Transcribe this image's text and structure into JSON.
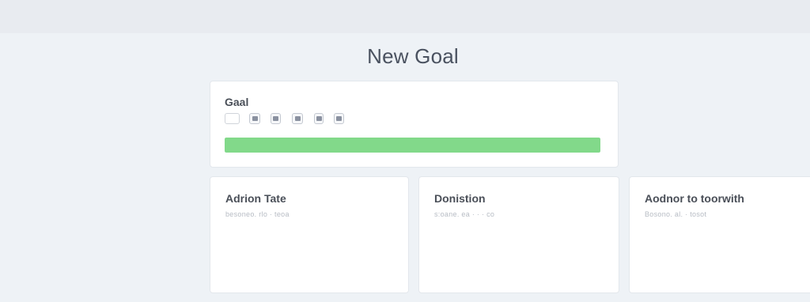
{
  "page": {
    "title": "New Goal"
  },
  "goal_card": {
    "label": "Gaal",
    "toolbar_icons": [
      "text-box-icon",
      "image-icon",
      "attachment-icon",
      "gallery-icon",
      "file-icon",
      "link-icon"
    ],
    "progress": 1.0,
    "progress_color": "#82d98a"
  },
  "sections": [
    {
      "title": "Adrion Tate",
      "subtitle": "besoneo. rlo ·  teoa"
    },
    {
      "title": "Donistion",
      "subtitle": "s:oane. ea ·  ·  ·  co"
    },
    {
      "title": "Aodnor to toorwith",
      "subtitle": "Bosono. al. ·  tosot"
    }
  ]
}
